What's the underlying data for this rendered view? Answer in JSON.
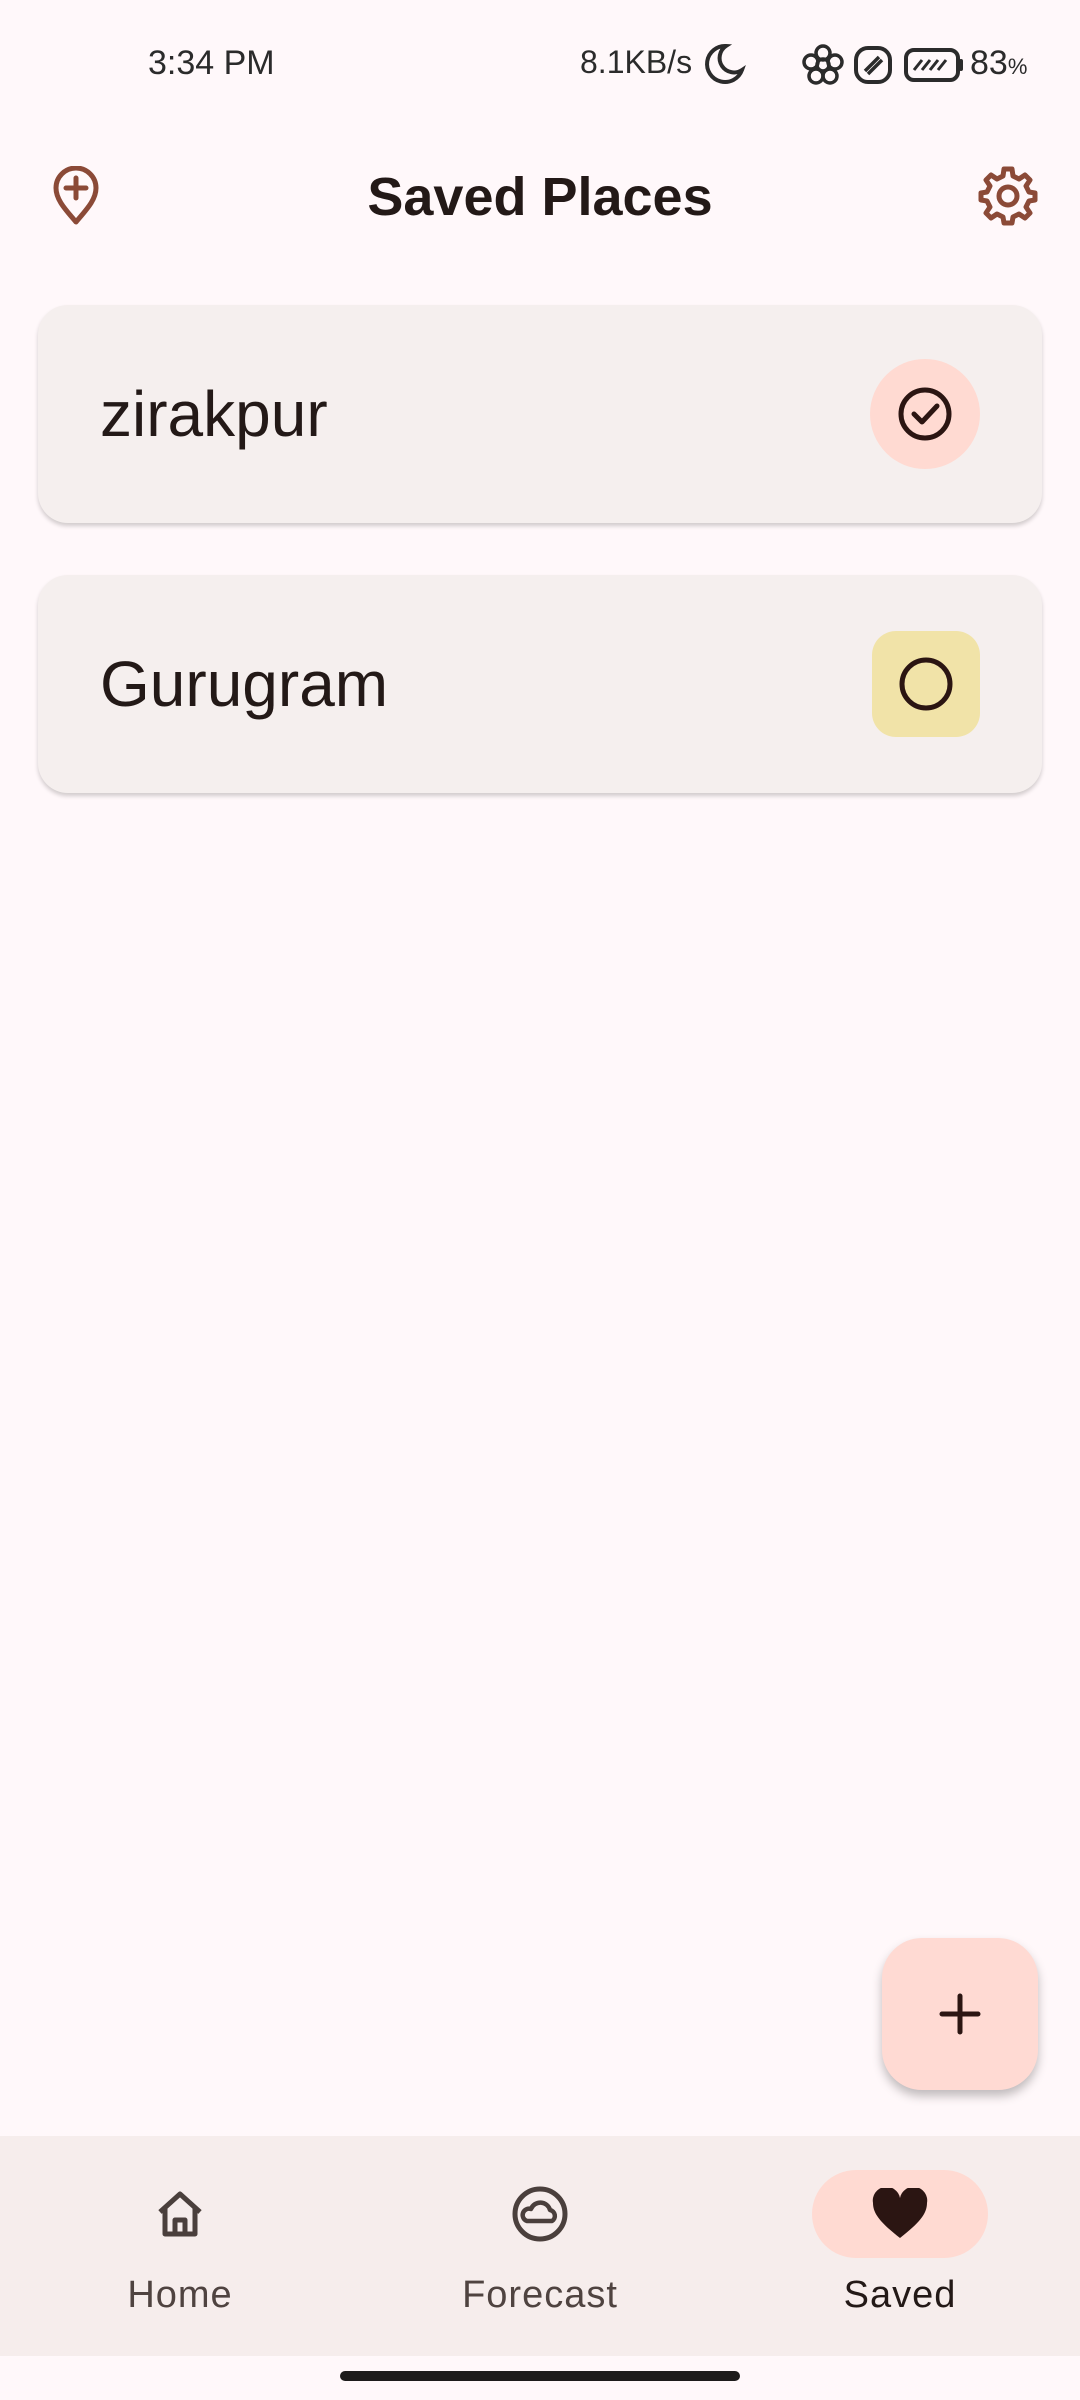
{
  "status_bar": {
    "time": "3:34 PM",
    "net_speed": "8.1KB/s",
    "battery_pct": "83",
    "battery_unit": "%",
    "icons": [
      "moon-icon",
      "flower-icon",
      "slash-box-icon",
      "battery-icon"
    ]
  },
  "appbar": {
    "title": "Saved Places",
    "left_icon": "add-location-icon",
    "right_icon": "gear-icon"
  },
  "places": [
    {
      "name": "zirakpur",
      "icon": "check-circle-icon"
    },
    {
      "name": "Gurugram",
      "icon": "empty-circle-icon"
    }
  ],
  "fab": {
    "icon": "plus-icon"
  },
  "nav": {
    "items": [
      {
        "label": "Home",
        "icon": "home-icon"
      },
      {
        "label": "Forecast",
        "icon": "cloud-icon"
      },
      {
        "label": "Saved",
        "icon": "heart-icon"
      }
    ],
    "active": "Saved"
  },
  "colors": {
    "background": "#FFF8FA",
    "accent_brown": "#8B4A37",
    "card": "#F5EFEE",
    "fab": "#FFDAD3",
    "yellow_chip": "#F1E3A8"
  }
}
